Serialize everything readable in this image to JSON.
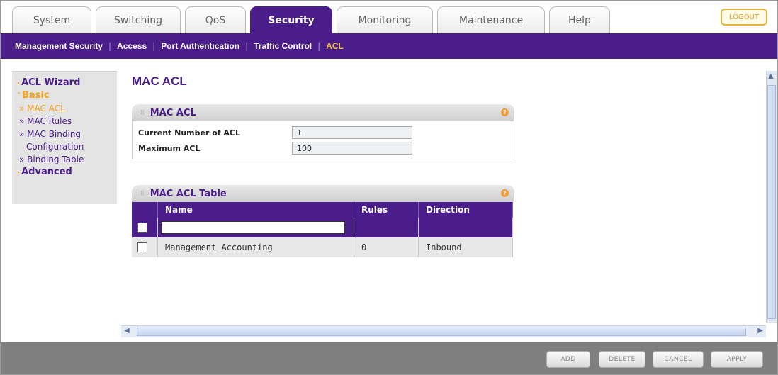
{
  "tabs": [
    "System",
    "Switching",
    "QoS",
    "Security",
    "Monitoring",
    "Maintenance",
    "Help"
  ],
  "active_tab": "Security",
  "logout_label": "LOGOUT",
  "subnav": [
    "Management Security",
    "Access",
    "Port Authentication",
    "Traffic Control",
    "ACL"
  ],
  "active_subnav": "ACL",
  "leftnav": {
    "acl_wizard": "ACL Wizard",
    "basic": "Basic",
    "mac_acl": "» MAC ACL",
    "mac_rules": "» MAC Rules",
    "mac_binding_1": "» MAC Binding",
    "mac_binding_2": "Configuration",
    "binding_table": "» Binding Table",
    "advanced": "Advanced"
  },
  "page_title": "MAC ACL",
  "mac_acl_panel": {
    "title": "MAC ACL",
    "current_label": "Current Number of ACL",
    "current_value": "1",
    "max_label": "Maximum ACL",
    "max_value": "100"
  },
  "table_panel": {
    "title": "MAC ACL Table",
    "columns": [
      "Name",
      "Rules",
      "Direction"
    ],
    "rows": [
      {
        "name": "Management_Accounting",
        "rules": "0",
        "direction": "Inbound"
      }
    ]
  },
  "buttons": {
    "add": "ADD",
    "delete": "DELETE",
    "cancel": "CANCEL",
    "apply": "APPLY"
  },
  "help_glyph": "?"
}
